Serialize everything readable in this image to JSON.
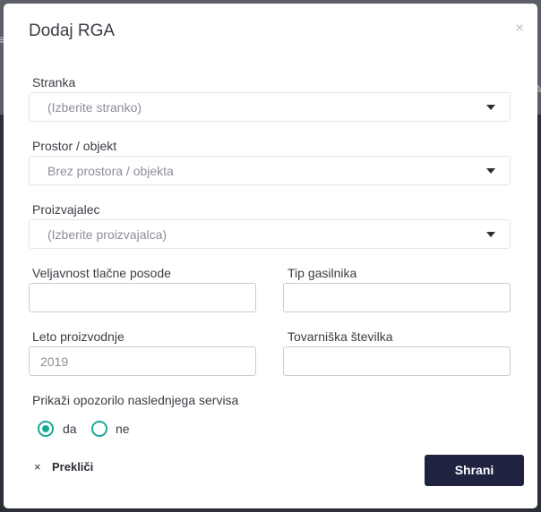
{
  "modal": {
    "title": "Dodaj RGA",
    "close_symbol": "×"
  },
  "form": {
    "stranka": {
      "label": "Stranka",
      "placeholder": "(Izberite stranko)"
    },
    "prostor": {
      "label": "Prostor / objekt",
      "value": "Brez prostora / objekta"
    },
    "proizvajalec": {
      "label": "Proizvajalec",
      "placeholder": "(Izberite proizvajalca)"
    },
    "veljavnost": {
      "label": "Veljavnost tlačne posode",
      "value": ""
    },
    "tip": {
      "label": "Tip gasilnika",
      "value": ""
    },
    "leto": {
      "label": "Leto proizvodnje",
      "value": "2019"
    },
    "tovarniska": {
      "label": "Tovarniška številka",
      "value": ""
    },
    "opozorilo": {
      "label": "Prikaži opozorilo naslednjega servisa",
      "options": [
        {
          "label": "da",
          "selected": true
        },
        {
          "label": "ne",
          "selected": false
        }
      ]
    }
  },
  "footer": {
    "cancel_icon": "×",
    "cancel_label": "Prekliči",
    "save_label": "Shrani"
  },
  "colors": {
    "accent": "#1aa896",
    "primary_button": "#1f2340"
  },
  "icons": [
    "close-icon",
    "caret-down-icon",
    "cancel-x-icon"
  ]
}
